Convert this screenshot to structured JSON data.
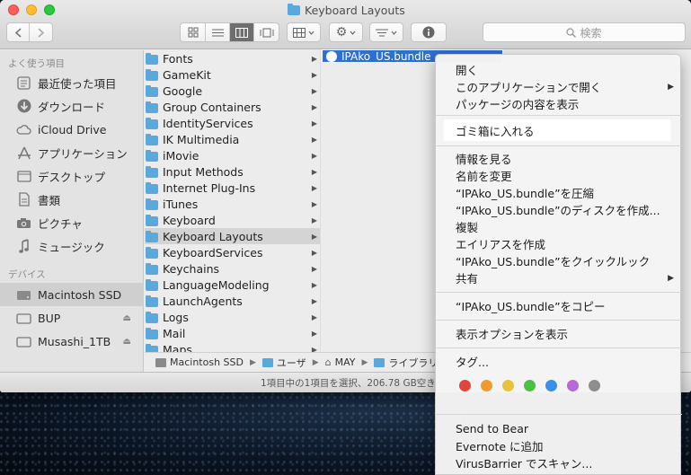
{
  "window": {
    "title": "Keyboard Layouts"
  },
  "toolbar": {
    "search_placeholder": "検索"
  },
  "sidebar": {
    "favorites_header": "よく使う項目",
    "favorites": [
      {
        "label": "最近使った項目",
        "icon": "clock-icon"
      },
      {
        "label": "ダウンロード",
        "icon": "download-icon"
      },
      {
        "label": "iCloud Drive",
        "icon": "cloud-icon"
      },
      {
        "label": "アプリケーション",
        "icon": "applications-icon"
      },
      {
        "label": "デスクトップ",
        "icon": "desktop-icon"
      },
      {
        "label": "書類",
        "icon": "documents-icon"
      },
      {
        "label": "ピクチャ",
        "icon": "camera-icon"
      },
      {
        "label": "ミュージック",
        "icon": "music-icon"
      }
    ],
    "devices_header": "デバイス",
    "devices": [
      {
        "label": "Macintosh SSD",
        "icon": "hard-drive-icon"
      },
      {
        "label": "BUP",
        "icon": "external-drive-icon"
      },
      {
        "label": "Musashi_1TB",
        "icon": "external-drive-icon"
      }
    ]
  },
  "column1": {
    "items": [
      "Fonts",
      "GameKit",
      "Google",
      "Group Containers",
      "IdentityServices",
      "IK Multimedia",
      "iMovie",
      "Input Methods",
      "Internet Plug-Ins",
      "iTunes",
      "Keyboard",
      "Keyboard Layouts",
      "KeyboardServices",
      "Keychains",
      "LanguageModeling",
      "LaunchAgents",
      "Logs",
      "Mail",
      "Maps"
    ],
    "selected": "Keyboard Layouts"
  },
  "column2": {
    "selected_item": "IPAko_US.bundle"
  },
  "pathbar": {
    "crumbs": [
      "Macintosh SSD",
      "ユーザ",
      "MAY",
      "ライブラリ"
    ]
  },
  "status": {
    "text": "1項目中の1項目を選択、206.78 GB空き"
  },
  "context_menu": {
    "open": "開く",
    "open_with": "このアプリケーションで開く",
    "show_package": "パッケージの内容を表示",
    "move_to_trash": "ゴミ箱に入れる",
    "get_info": "情報を見る",
    "rename": "名前を変更",
    "compress": "“IPAko_US.bundle”を圧縮",
    "burn": "“IPAko_US.bundle”のディスクを作成...",
    "duplicate": "複製",
    "make_alias": "エイリアスを作成",
    "quick_look": "“IPAko_US.bundle”をクイックルック",
    "share": "共有",
    "copy": "“IPAko_US.bundle”をコピー",
    "view_options": "表示オプションを表示",
    "tags": "タグ...",
    "tag_colors": [
      "#e0453e",
      "#ef9a2c",
      "#e9c23b",
      "#4cbf45",
      "#3c8fe8",
      "#b769d5",
      "#8e8e8e"
    ],
    "send_to_bear": "Send to Bear",
    "evernote": "Evernote に追加",
    "virusbarrier": "VirusBarrier でスキャン..."
  },
  "colors": {
    "selection_blue": "#2d6fd2",
    "folder_blue": "#5aa9dd"
  }
}
